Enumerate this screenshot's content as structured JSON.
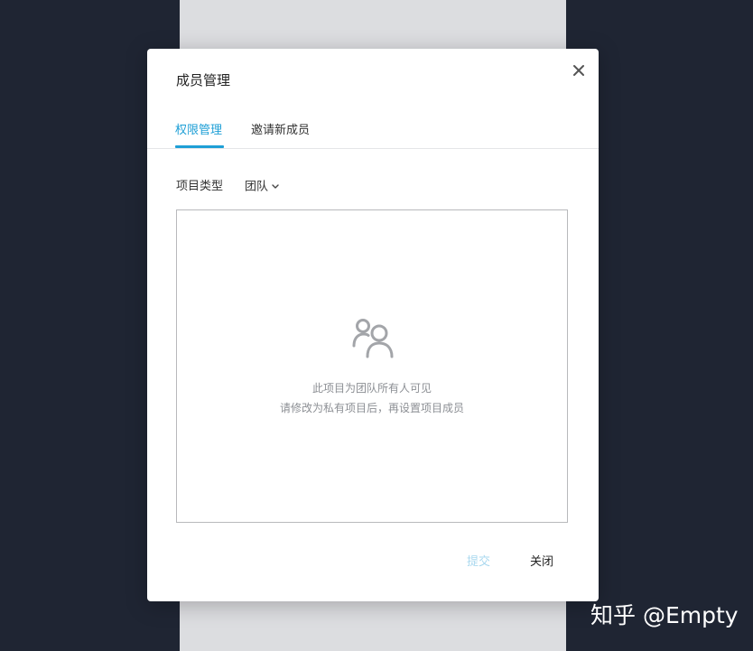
{
  "modal": {
    "title": "成员管理",
    "tabs": [
      {
        "label": "权限管理",
        "active": true
      },
      {
        "label": "邀请新成员",
        "active": false
      }
    ],
    "project_type": {
      "label": "项目类型",
      "selected": "团队"
    },
    "empty_state": {
      "icon": "users-icon",
      "line1": "此项目为团队所有人可见",
      "line2": "请修改为私有项目后，再设置项目成员"
    },
    "footer": {
      "submit_label": "提交",
      "close_label": "关闭"
    }
  },
  "watermark": "知乎 @Empty",
  "colors": {
    "accent": "#1e9fd6",
    "submit_disabled": "#a9d8ef",
    "background": "#1f2533"
  }
}
